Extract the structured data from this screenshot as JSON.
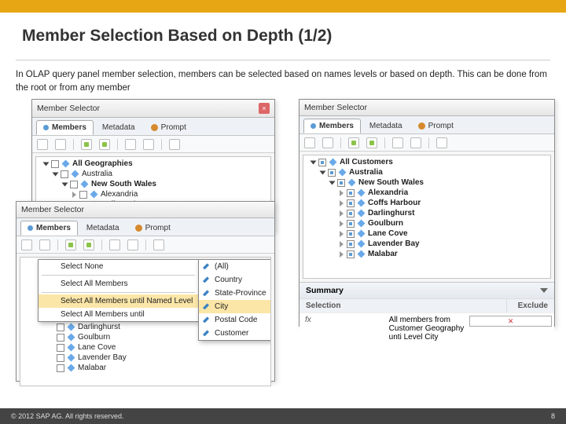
{
  "title": "Member Selection Based on Depth (1/2)",
  "desc": "In OLAP query panel member selection, members can be selected based on names levels or based on depth. This can be done from the root or from any member",
  "panel": {
    "title": "Member Selector",
    "tabs": {
      "members": "Members",
      "metadata": "Metadata",
      "prompt": "Prompt"
    }
  },
  "left_tree": {
    "root": "All Geographies",
    "country": "Australia",
    "state": "New South Wales",
    "cities": [
      "Alexandria",
      "Coffs Harbour",
      "Darlinghurst",
      "Goulburn",
      "Lane Cove"
    ]
  },
  "right_tree": {
    "root": "All Customers",
    "country": "Australia",
    "state": "New South Wales",
    "cities": [
      "Alexandria",
      "Coffs Harbour",
      "Darlinghurst",
      "Goulburn",
      "Lane Cove",
      "Lavender Bay",
      "Malabar"
    ]
  },
  "bottom_tree_cities": [
    "Darlinghurst",
    "Goulburn",
    "Lane Cove",
    "Lavender Bay",
    "Malabar"
  ],
  "menu": {
    "select_none": "Select None",
    "select_all": "Select All Members",
    "until_named": "Select All Members until Named Level",
    "until": "Select All Members until"
  },
  "levels": [
    "(All)",
    "Country",
    "State-Province",
    "City",
    "Postal Code",
    "Customer"
  ],
  "summary": {
    "header": "Summary",
    "col_sel": "Selection",
    "col_exc": "Exclude",
    "text": "All members from Customer Geography unti Level City"
  },
  "footer": {
    "copyright": "© 2012 SAP AG. All rights reserved.",
    "page": "8"
  }
}
